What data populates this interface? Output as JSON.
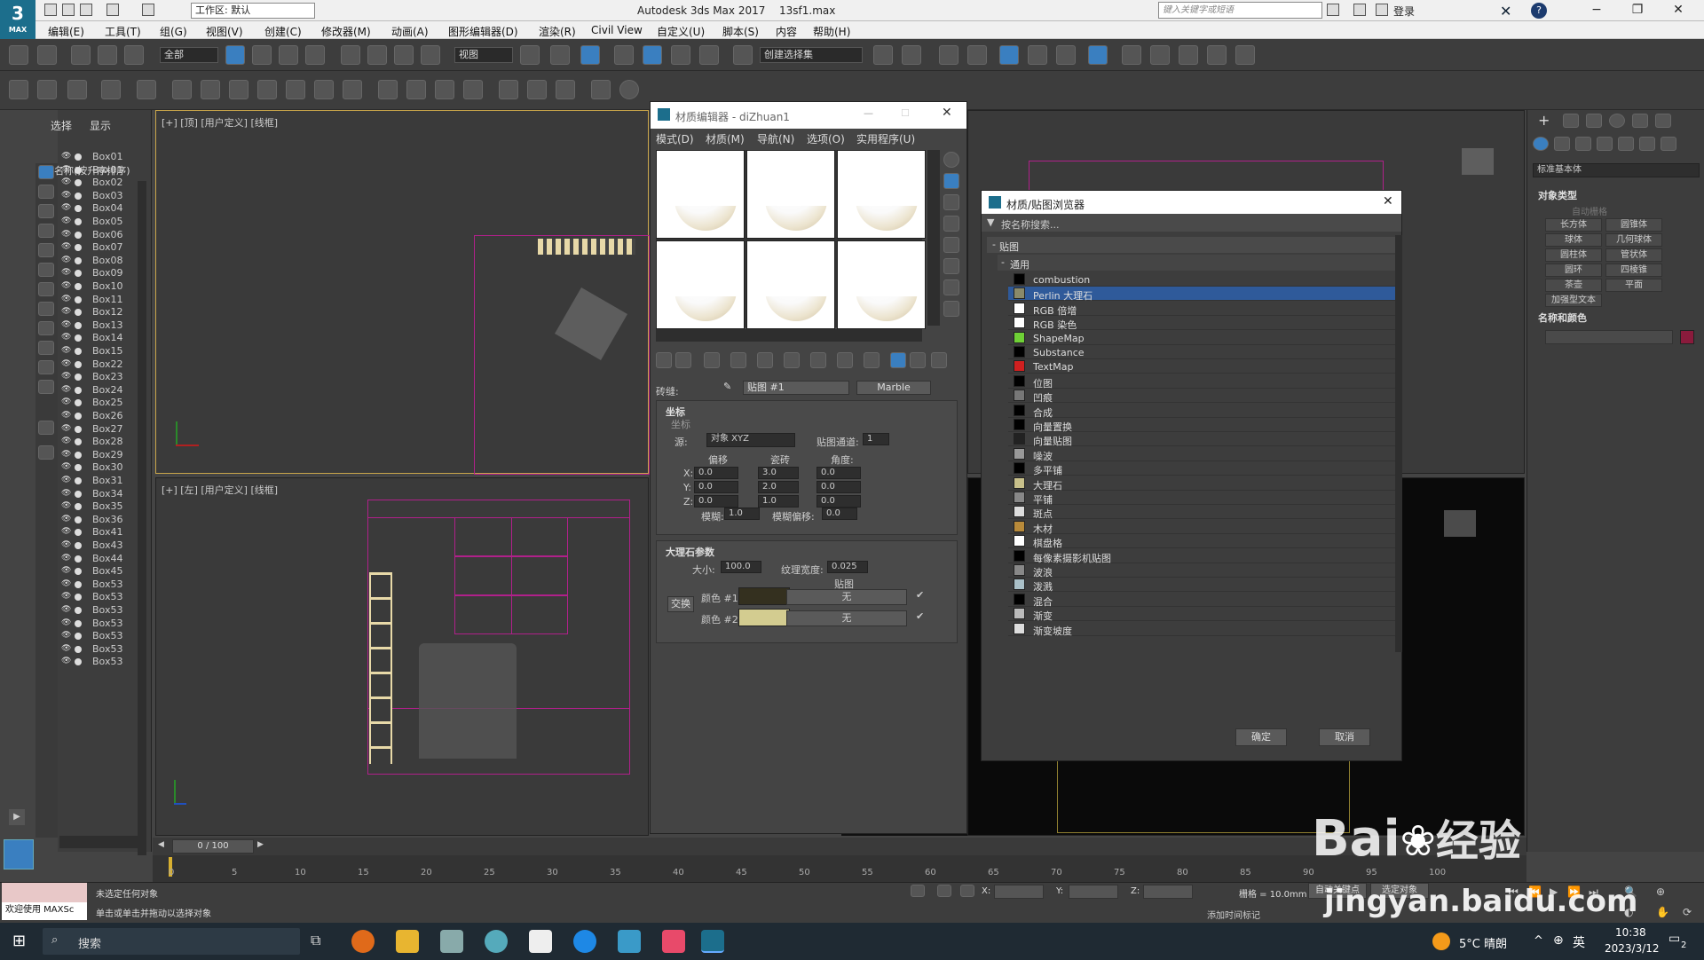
{
  "app": {
    "title": "Autodesk 3ds Max 2017",
    "file": "13sf1.max",
    "logo_main": "3",
    "logo_sub": "MAX",
    "workspace": "工作区: 默认",
    "search_placeholder": "键入关键字或短语",
    "login": "登录"
  },
  "menu": [
    "编辑(E)",
    "工具(T)",
    "组(G)",
    "视图(V)",
    "创建(C)",
    "修改器(M)",
    "动画(A)",
    "图形编辑器(D)",
    "渲染(R)",
    "Civil View",
    "自定义(U)",
    "脚本(S)",
    "内容",
    "帮助(H)"
  ],
  "toolbar": {
    "selection_filter": "全部",
    "ref_coord": "视图",
    "named_selection": "创建选择集"
  },
  "scene_explorer": {
    "tabs": [
      "选择",
      "显示"
    ],
    "header": "名称(按升序排序)",
    "items": [
      "Box01",
      "Box01",
      "Box02",
      "Box03",
      "Box04",
      "Box05",
      "Box06",
      "Box07",
      "Box08",
      "Box09",
      "Box10",
      "Box11",
      "Box12",
      "Box13",
      "Box14",
      "Box15",
      "Box22",
      "Box23",
      "Box24",
      "Box25",
      "Box26",
      "Box27",
      "Box28",
      "Box29",
      "Box30",
      "Box31",
      "Box34",
      "Box35",
      "Box36",
      "Box41",
      "Box43",
      "Box44",
      "Box45",
      "Box53",
      "Box53",
      "Box53",
      "Box53",
      "Box53",
      "Box53",
      "Box53"
    ]
  },
  "viewports": {
    "top_label": "[+] [顶] [用户定义] [线框]",
    "left_label": "[+] [左] [用户定义] [线框]"
  },
  "material_editor": {
    "title": "材质编辑器 - diZhuan1",
    "menus": [
      "模式(D)",
      "材质(M)",
      "导航(N)",
      "选项(O)",
      "实用程序(U)"
    ],
    "name_label": "砖缝:",
    "map_name": "贴图 #1",
    "map_type": "Marble",
    "coords": {
      "header": "坐标",
      "sub": "坐标",
      "source_label": "源:",
      "source": "对象 XYZ",
      "channel_label": "贴图通道:",
      "channel": "1",
      "col_offset": "偏移",
      "col_tiling": "瓷砖",
      "col_angle": "角度:",
      "rows": [
        {
          "axis": "X:",
          "offset": "0.0",
          "tiling": "3.0",
          "angle": "0.0"
        },
        {
          "axis": "Y:",
          "offset": "0.0",
          "tiling": "2.0",
          "angle": "0.0"
        },
        {
          "axis": "Z:",
          "offset": "0.0",
          "tiling": "1.0",
          "angle": "0.0"
        }
      ],
      "blur_label": "模糊:",
      "blur": "1.0",
      "blur_offset_label": "模糊偏移:",
      "blur_offset": "0.0"
    },
    "marble": {
      "header": "大理石参数",
      "size_label": "大小:",
      "size": "100.0",
      "vein_label": "纹理宽度:",
      "vein": "0.025",
      "maps_label": "贴图",
      "swap": "交换",
      "color1_label": "颜色 #1",
      "color2_label": "颜色 #2",
      "map_none": "无",
      "color1": "#34301f",
      "color2": "#d3cc90"
    }
  },
  "browser": {
    "title": "材质/贴图浏览器",
    "search": "按名称搜索...",
    "group": "贴图",
    "subgroup": "通用",
    "items": [
      {
        "name": "combustion",
        "color": "#000000"
      },
      {
        "name": "Perlin 大理石",
        "color": "#8a8a6a",
        "selected": true
      },
      {
        "name": "RGB 倍增",
        "color": "#ffffff"
      },
      {
        "name": "RGB 染色",
        "color": "#ffffff"
      },
      {
        "name": "ShapeMap",
        "color": "#6fd136"
      },
      {
        "name": "Substance",
        "color": "#000000"
      },
      {
        "name": "TextMap",
        "color": "#d02020"
      },
      {
        "name": "位图",
        "color": "#000000"
      },
      {
        "name": "凹痕",
        "color": "#777777"
      },
      {
        "name": "合成",
        "color": "#000000"
      },
      {
        "name": "向量置换",
        "color": "#000000"
      },
      {
        "name": "向量贴图",
        "color": "#222222"
      },
      {
        "name": "噪波",
        "color": "#999999"
      },
      {
        "name": "多平铺",
        "color": "#000000"
      },
      {
        "name": "大理石",
        "color": "#c8c08a"
      },
      {
        "name": "平铺",
        "color": "#888888"
      },
      {
        "name": "斑点",
        "color": "#dddddd"
      },
      {
        "name": "木材",
        "color": "#b88a3a"
      },
      {
        "name": "棋盘格",
        "color": "#ffffff"
      },
      {
        "name": "每像素摄影机贴图",
        "color": "#000000"
      },
      {
        "name": "波浪",
        "color": "#888888"
      },
      {
        "name": "泼溅",
        "color": "#aac0c8"
      },
      {
        "name": "混合",
        "color": "#000000"
      },
      {
        "name": "渐变",
        "color": "#bbbbbb"
      },
      {
        "name": "渐变坡度",
        "color": "#dddddd"
      }
    ],
    "ok": "确定",
    "cancel": "取消"
  },
  "command_panel": {
    "category": "标准基本体",
    "object_type": "对象类型",
    "autogrid": "自动栅格",
    "buttons": [
      "长方体",
      "圆锥体",
      "球体",
      "几何球体",
      "圆柱体",
      "管状体",
      "圆环",
      "四棱锥",
      "茶壶",
      "平面",
      "加强型文本"
    ],
    "name_color": "名称和颜色",
    "object_color": "#8a1b3c"
  },
  "timeline": {
    "frame": "0 / 100",
    "ticks": [
      "0",
      "5",
      "10",
      "15",
      "20",
      "25",
      "30",
      "35",
      "40",
      "45",
      "50",
      "55",
      "60",
      "65",
      "70",
      "75",
      "80",
      "85",
      "90",
      "95",
      "100"
    ]
  },
  "status": {
    "maxscript": "欢迎使用 MAXSc",
    "line1": "未选定任何对象",
    "line2": "单击或单击并拖动以选择对象",
    "x_label": "X:",
    "y_label": "Y:",
    "z_label": "Z:",
    "grid": "栅格 = 10.0mm",
    "add_time_tag": "添加时间标记",
    "autokey": "自动关键点",
    "selected": "选定对象"
  },
  "taskbar": {
    "search": "搜索",
    "weather": "5°C 晴朗",
    "ime": "英",
    "time": "10:38",
    "date": "2023/3/12",
    "notifications": "2"
  },
  "watermark": {
    "brand": "Bai",
    "brand2": "经验",
    "url": "jingyan.baidu.com"
  }
}
